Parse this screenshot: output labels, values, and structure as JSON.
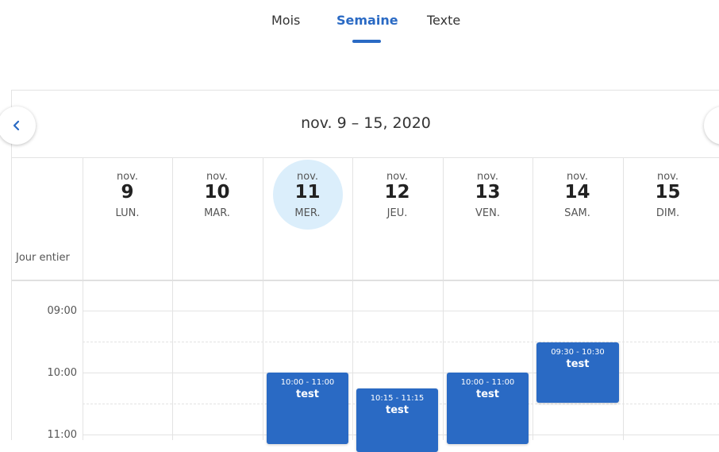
{
  "view_tabs": [
    {
      "label": "Mois",
      "active": false
    },
    {
      "label": "Semaine",
      "active": true
    },
    {
      "label": "Texte",
      "active": false
    }
  ],
  "range_title": "nov. 9 – 15, 2020",
  "nav": {
    "prev_icon": "chevron-left-icon",
    "next_icon": "chevron-right-icon"
  },
  "allday_label": "Jour entier",
  "days": [
    {
      "month": "nov.",
      "day": "9",
      "weekday": "LUN."
    },
    {
      "month": "nov.",
      "day": "10",
      "weekday": "MAR."
    },
    {
      "month": "nov.",
      "day": "11",
      "weekday": "MER.",
      "today": true
    },
    {
      "month": "nov.",
      "day": "12",
      "weekday": "JEU."
    },
    {
      "month": "nov.",
      "day": "13",
      "weekday": "VEN."
    },
    {
      "month": "nov.",
      "day": "14",
      "weekday": "SAM."
    },
    {
      "month": "nov.",
      "day": "15",
      "weekday": "DIM."
    }
  ],
  "times": [
    "09:00",
    "10:00",
    "11:00"
  ],
  "events": [
    {
      "time": "10:00 - 11:00",
      "title": "test"
    },
    {
      "time": "10:15 - 11:15",
      "title": "test"
    },
    {
      "time": "10:00 - 11:00",
      "title": "test"
    },
    {
      "time": "09:30 - 10:30",
      "title": "test"
    }
  ],
  "colors": {
    "accent": "#2a6ac4",
    "today_bg": "#dbeefb",
    "event_bg": "#2a6ac4"
  }
}
